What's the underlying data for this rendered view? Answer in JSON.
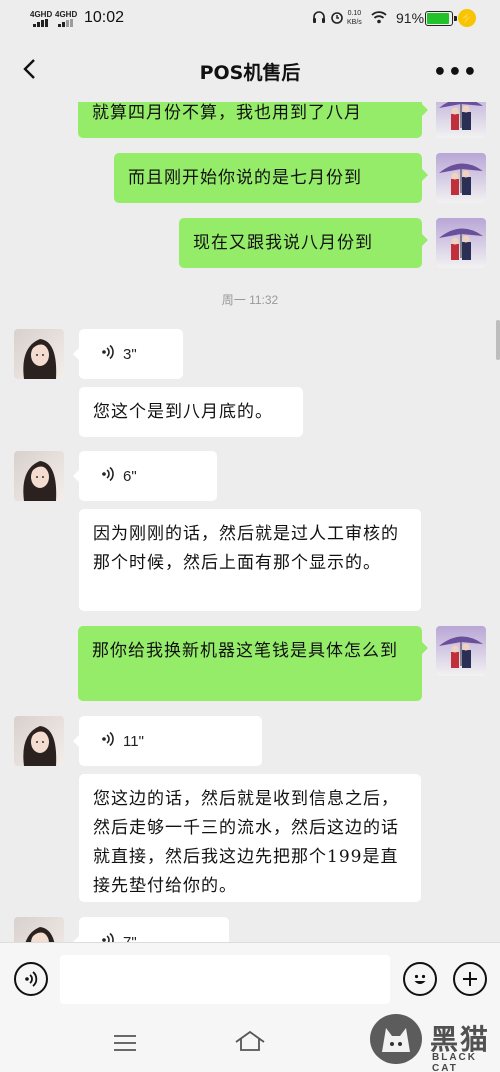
{
  "status_bar": {
    "network1": "4GHD",
    "network2": "4GHD",
    "time": "10:02",
    "speed_value": "0.10",
    "speed_unit": "KB/s",
    "battery_pct": "91%",
    "battery_level": 0.91
  },
  "header": {
    "title": "POS机售后",
    "more": "•••"
  },
  "messages": [
    {
      "side": "me",
      "text": "就算四月份不算，我也用到了八月"
    },
    {
      "side": "me",
      "text": "而且刚开始你说的是七月份到"
    },
    {
      "side": "me",
      "text": "现在又跟我说八月份到"
    },
    {
      "side": "time",
      "text": "周一 11:32"
    },
    {
      "side": "them",
      "voice": "3\""
    },
    {
      "side": "them",
      "text": "您这个是到八月底的。"
    },
    {
      "side": "them",
      "voice": "6\""
    },
    {
      "side": "them",
      "text": "因为刚刚的话，然后就是过人工审核的那个时候，然后上面有那个显示的。"
    },
    {
      "side": "me",
      "text": "那你给我换新机器这笔钱是具体怎么到"
    },
    {
      "side": "them",
      "voice": "11\""
    },
    {
      "side": "them",
      "text": "您这边的话，然后就是收到信息之后，然后走够一千三的流水，然后这边的话就直接，然后我这边先把那个199是直接先垫付给你的。"
    },
    {
      "side": "them",
      "voice": "7\""
    }
  ],
  "watermark": {
    "cn": "黑猫",
    "en": "BLACK CAT"
  },
  "colors": {
    "my_bubble": "#95ec69",
    "their_bubble": "#ffffff",
    "background": "#ededed"
  }
}
